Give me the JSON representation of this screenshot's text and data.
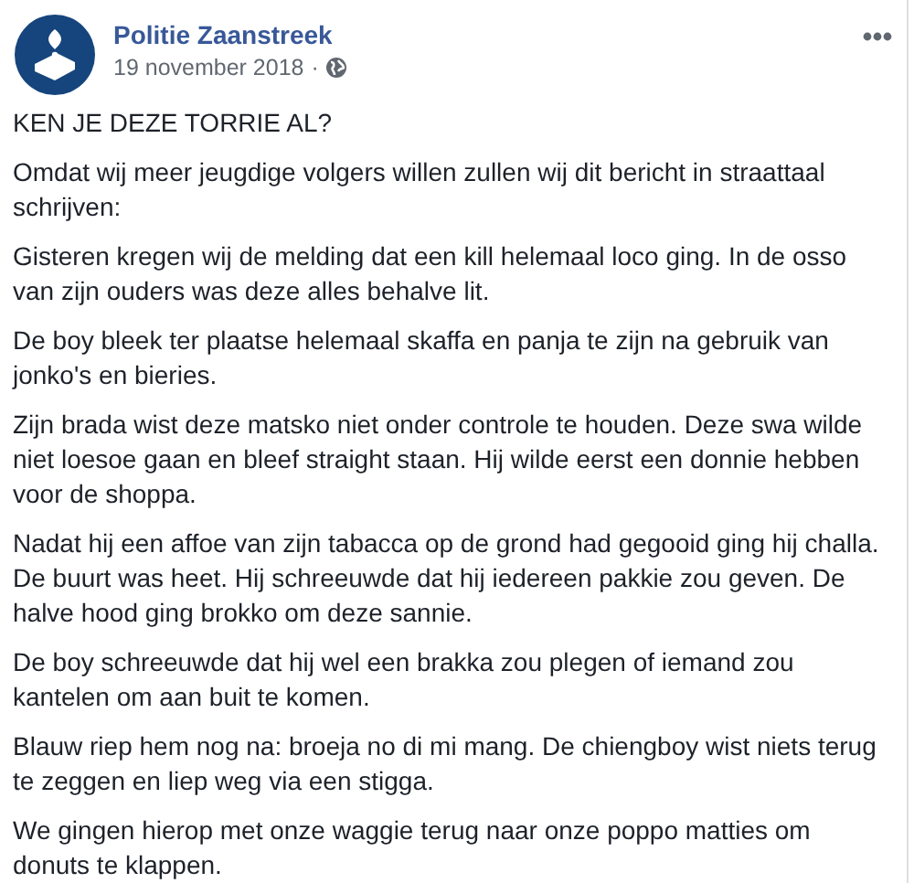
{
  "post": {
    "author": "Politie Zaanstreek",
    "date": "19 november 2018",
    "separator": "·",
    "paragraphs": [
      "KEN JE DEZE TORRIE AL?",
      "Omdat wij meer jeugdige volgers willen zullen wij dit bericht in straattaal schrijven:",
      "Gisteren kregen wij de melding dat een kill helemaal loco ging. In de osso van zijn ouders was deze alles behalve lit.",
      "De boy bleek ter plaatse helemaal skaffa en panja te zijn na gebruik van jonko's en bieries.",
      "Zijn brada wist deze matsko niet onder controle te houden. Deze swa wilde niet loesoe gaan en bleef straight staan. Hij wilde eerst een donnie hebben voor de shoppa.",
      "Nadat hij een affoe van zijn tabacca op de grond had gegooid ging hij challa. De buurt was heet. Hij schreeuwde dat hij iedereen pakkie zou geven. De halve hood ging brokko om deze sannie.",
      "De boy schreeuwde dat hij wel een brakka zou plegen of iemand zou kantelen om aan buit te komen.",
      "Blauw riep hem nog na: broeja no di mi mang. De chiengboy wist niets terug te zeggen en liep weg via een stigga.",
      "We gingen hierop met onze waggie terug naar onze poppo matties om donuts te klappen."
    ]
  }
}
